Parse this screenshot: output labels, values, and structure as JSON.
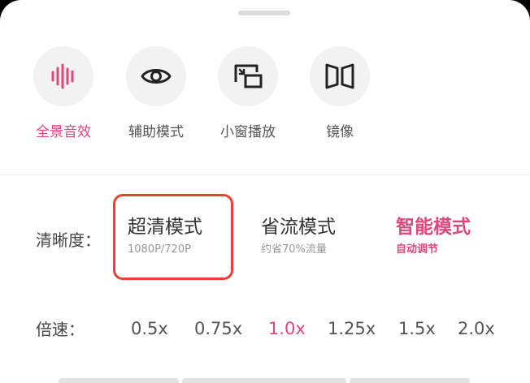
{
  "actions": [
    {
      "icon": "audio-wave-icon",
      "label": "全景音效",
      "active": true
    },
    {
      "icon": "eye-icon",
      "label": "辅助模式",
      "active": false
    },
    {
      "icon": "picture-in-picture-icon",
      "label": "小窗播放",
      "active": false
    },
    {
      "icon": "mirror-icon",
      "label": "镜像",
      "active": false
    }
  ],
  "quality": {
    "label": "清晰度：",
    "options": [
      {
        "title": "超清模式",
        "subtitle": "1080P/720P",
        "highlighted": true
      },
      {
        "title": "省流模式",
        "subtitle": "约省70%流量"
      },
      {
        "title": "智能模式",
        "subtitle": "自动调节",
        "active": true
      }
    ]
  },
  "speed": {
    "label": "倍速：",
    "options": [
      "0.5x",
      "0.75x",
      "1.0x",
      "1.25x",
      "1.5x",
      "2.0x"
    ],
    "selected": "1.0x"
  },
  "colors": {
    "accent": "#e0487a",
    "highlight_box": "#e8412f"
  }
}
